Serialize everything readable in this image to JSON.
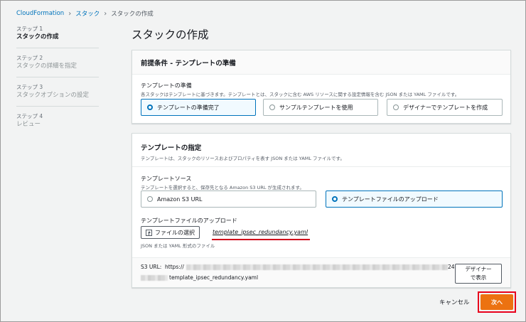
{
  "breadcrumb": {
    "items": [
      "CloudFormation",
      "スタック"
    ],
    "current": "スタックの作成"
  },
  "steps": [
    {
      "num": "ステップ 1",
      "name": "スタックの作成"
    },
    {
      "num": "ステップ 2",
      "name": "スタックの詳細を指定"
    },
    {
      "num": "ステップ 3",
      "name": "スタックオプションの設定"
    },
    {
      "num": "ステップ 4",
      "name": "レビュー"
    }
  ],
  "page_title": "スタックの作成",
  "prereq": {
    "title": "前提条件 - テンプレートの準備",
    "label": "テンプレートの準備",
    "desc": "各スタックはテンプレートに基づきます。テンプレートとは、スタックに含む AWS リソースに関する設定情報を含む JSON または YAML ファイルです。",
    "options": [
      "テンプレートの準備完了",
      "サンプルテンプレートを使用",
      "デザイナーでテンプレートを作成"
    ],
    "selected": 0
  },
  "template": {
    "title": "テンプレートの指定",
    "desc": "テンプレートは、スタックのリソースおよびプロパティを表す JSON または YAML ファイルです。",
    "source_label": "テンプレートソース",
    "source_desc": "テンプレートを選択すると、保存先となる Amazon S3 URL が生成されます。",
    "source_options": [
      "Amazon S3 URL",
      "テンプレートファイルのアップロード"
    ],
    "source_selected": 1,
    "upload_label": "テンプレートファイルのアップロード",
    "choose_file": "ファイルの選択",
    "filename": "template_ipsec_redundancy.yaml",
    "upload_hint": "JSON または YAML 形式のファイル",
    "s3_label": "S3 URL:",
    "s3_prefix": "https://",
    "s3_suffix_char": "24",
    "s3_file": "template_ipsec_redundancy.yaml",
    "designer_btn_line1": "デザイナー",
    "designer_btn_line2": "で表示"
  },
  "footer": {
    "cancel": "キャンセル",
    "next": "次へ"
  },
  "colors": {
    "link": "#0073bb",
    "primary": "#ec7211",
    "highlight": "#e8001c"
  }
}
